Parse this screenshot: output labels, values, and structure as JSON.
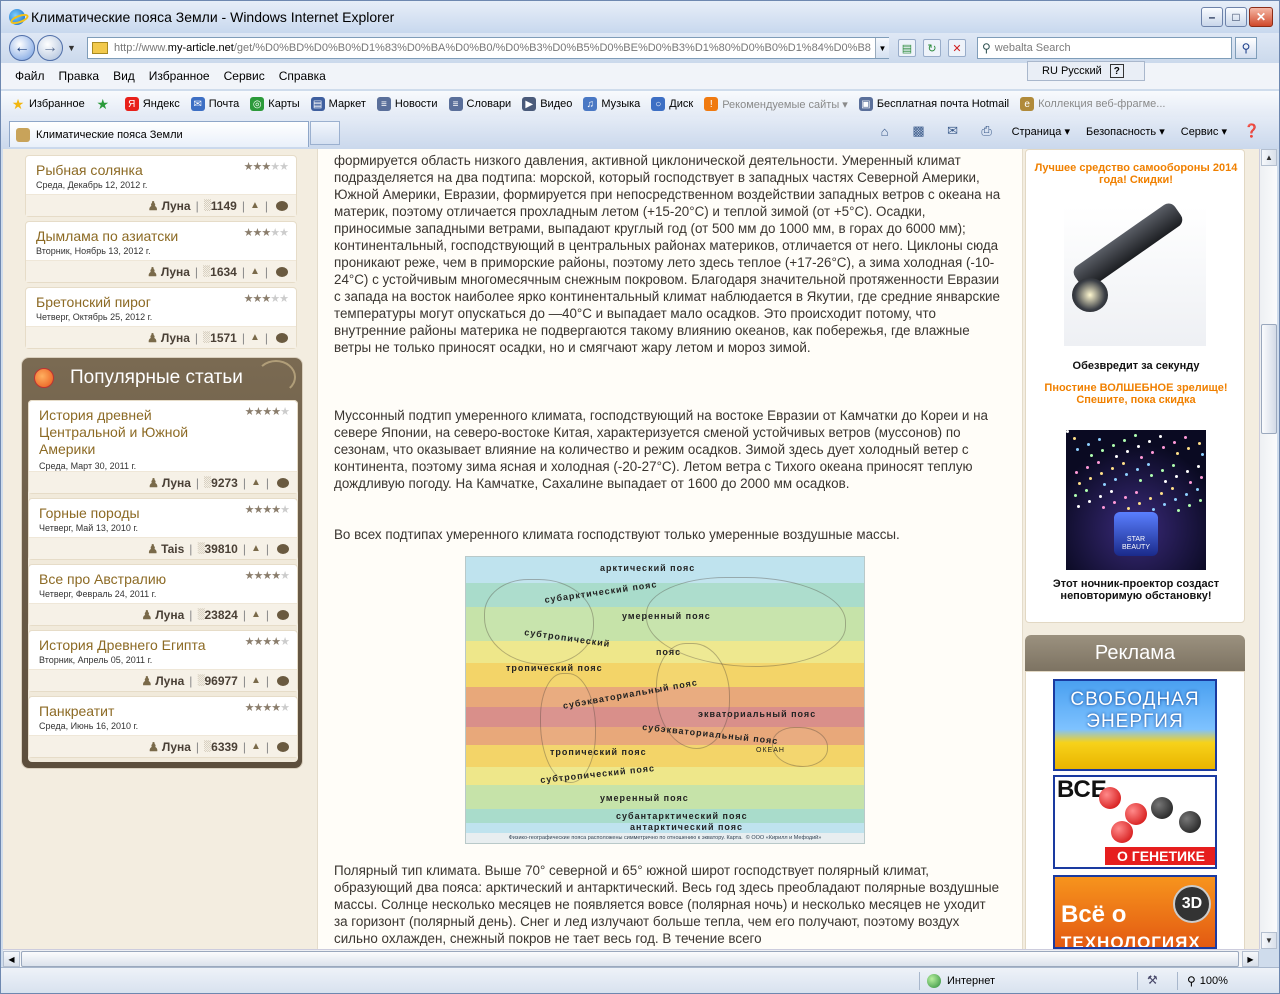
{
  "window": {
    "title": "Климатические пояса Земли - Windows Internet Explorer",
    "minimize": "–",
    "maximize": "□",
    "close": "✕"
  },
  "address": {
    "prefix": "http://www.",
    "host": "my-article.net",
    "path": "/get/%D0%BD%D0%B0%D1%83%D0%BA%D0%B0/%D0%B3%D0%B5%D0%BE%D0%B3%D1%80%D0%B0%D1%84%D0%B8"
  },
  "search": {
    "placeholder": "webalta Search"
  },
  "language": {
    "label": "RU Русский",
    "help": "?"
  },
  "menu": [
    "Файл",
    "Правка",
    "Вид",
    "Избранное",
    "Сервис",
    "Справка"
  ],
  "favorites": {
    "main": "Избранное",
    "items": [
      {
        "label": "Яндекс",
        "icon": "yandex-icon",
        "color": "#e8201a",
        "glyph": "Я"
      },
      {
        "label": "Почта",
        "icon": "mail-icon",
        "color": "#3d6fc4",
        "glyph": "✉"
      },
      {
        "label": "Карты",
        "icon": "maps-icon",
        "color": "#2c9a3a",
        "glyph": "◎"
      },
      {
        "label": "Маркет",
        "icon": "market-icon",
        "color": "#3f5f9f",
        "glyph": "▤"
      },
      {
        "label": "Новости",
        "icon": "news-icon",
        "color": "#5a6f9a",
        "glyph": "≡"
      },
      {
        "label": "Словари",
        "icon": "dictionary-icon",
        "color": "#5a6f9a",
        "glyph": "≡"
      },
      {
        "label": "Видео",
        "icon": "video-icon",
        "color": "#4a5a7a",
        "glyph": "▶"
      },
      {
        "label": "Музыка",
        "icon": "music-icon",
        "color": "#4a78c4",
        "glyph": "♫"
      },
      {
        "label": "Диск",
        "icon": "disk-icon",
        "color": "#3d6fc4",
        "glyph": "○"
      },
      {
        "label": "Рекомендуемые сайты ▾",
        "icon": "suggested-sites-icon",
        "color": "#f07a10",
        "glyph": "!",
        "dim": true
      },
      {
        "label": "Бесплатная почта Hotmail",
        "icon": "hotmail-icon",
        "color": "#5a6f9a",
        "glyph": "▣"
      },
      {
        "label": "Коллекция веб-фрагме...",
        "icon": "webslice-icon",
        "color": "#b08a3a",
        "glyph": "e",
        "dim": true
      }
    ]
  },
  "tab": {
    "title": "Климатические пояса Земли"
  },
  "commands": {
    "page": "Страница ▾",
    "safety": "Безопасность ▾",
    "service": "Сервис ▾"
  },
  "recipes": [
    {
      "title": "Рыбная солянка",
      "date": "Среда, Декабрь 12, 2012 г.",
      "author": "Луна",
      "views": "1149",
      "stars": 3
    },
    {
      "title": "Дымлама по азиатски",
      "date": "Вторник, Ноябрь 13, 2012 г.",
      "author": "Луна",
      "views": "1634",
      "stars": 3
    },
    {
      "title": "Бретонский пирог",
      "date": "Четверг, Октябрь 25, 2012 г.",
      "author": "Луна",
      "views": "1571",
      "stars": 3
    }
  ],
  "popular": {
    "title": "Популярные статьи",
    "items": [
      {
        "title": "История древней Центральной и Южной Америки",
        "date": "Среда, Март 30, 2011 г.",
        "author": "Луна",
        "views": "9273",
        "stars": 4
      },
      {
        "title": "Горные породы",
        "date": "Четверг, Май 13, 2010 г.",
        "author": "Tais",
        "views": "39810",
        "stars": 4
      },
      {
        "title": "Все про Австралию",
        "date": "Четверг, Февраль 24, 2011 г.",
        "author": "Луна",
        "views": "23824",
        "stars": 4
      },
      {
        "title": "История Древнего Египта",
        "date": "Вторник, Апрель 05, 2011 г.",
        "author": "Луна",
        "views": "96977",
        "stars": 4
      },
      {
        "title": "Панкреатит",
        "date": "Среда, Июнь 16, 2010 г.",
        "author": "Луна",
        "views": "6339",
        "stars": 4
      }
    ]
  },
  "article": {
    "p1": "формируется область низкого давления, активной циклонической деятельности. Умеренный климат подразделяется на два подтипа: морской, который господствует в западных частях Северной Америки, Южной Америки, Евразии, формируется при непосредственном воздействии западных ветров с океана на материк, поэтому отличается прохладным летом (+15-20°С) и теплой зимой (от +5°С). Осадки, приносимые западными ветрами, выпадают круглый год (от 500 мм до 1000 мм, в горах до 6000 мм); континентальный, господствующий в центральных районах материков, отличается от него. Циклоны сюда проникают реже, чем в приморские районы, поэтому лето здесь теплое (+17-26°С), а зима холодная (-10-24°С) с устойчивым многомесячным снежным покровом. Благодаря значительной протяженности Евразии с запада на восток наиболее ярко континентальный климат наблюдается в Якутии, где средние январские температуры могут опускаться до —40°С и выпадает мало осадков. Это происходит потому, что внутренние районы материка не подвергаются такому влиянию океанов, как побережья, где влажные ветры не только приносят осадки, но и смягчают жару летом и мороз зимой.",
    "p2": "Муссонный подтип умеренного климата, господствующий на востоке Евразии от Камчатки до Кореи и на севере Японии, на северо-востоке Китая, характеризуется сменой устойчивых ветров (муссонов) по сезонам, что оказывает влияние на количество и режим осадков. Зимой здесь дует холодный ветер с континента, поэтому зима ясная и холодная (-20-27°С). Летом ветра с Тихого океана приносят теплую дождливую погоду. На Камчатке, Сахалине выпадает от 1600 до 2000 мм осадков.",
    "p3": "Во всех подтипах умеренного климата господствуют только умеренные воздушные массы.",
    "p4": "Полярный тип климата. Выше 70° северной и 65° южной широт господствует полярный климат, образующий два пояса: арктический и антарктический. Весь год здесь преобладают полярные воздушные массы. Солнце несколько месяцев не появляется вовсе (полярная ночь) и несколько месяцев не уходит за горизонт (полярный день). Снег и лед излучают больше тепла, чем его получают, поэтому воздух сильно охлажден, снежный покров не тает весь год. В течение всего"
  },
  "map": {
    "labels": {
      "arctic": "арктический пояс",
      "subarctic": "субарктический пояс",
      "temperate_n": "умеренный пояс",
      "subtropical_n": "субтропический",
      "subtropical_n2": "пояс",
      "tropical_n": "тропический пояс",
      "subequatorial_n": "субэкваториальный пояс",
      "equatorial": "экваториальный пояс",
      "subequatorial_s": "субэкваториальный пояс",
      "tropical_s": "тропический пояс",
      "subtropical_s": "субтропический пояс",
      "temperate_s": "умеренный пояс",
      "subantarctic": "субантарктический пояс",
      "antarctic": "антарктический пояс",
      "ocean": "ОКЕАН"
    },
    "caption": "Физико-географические пояса расположены симметрично по отношению к экватору. Карта.",
    "copyright": "© ООО «Кирилл и Мефодий»",
    "colors": {
      "arctic": "#bfe3ee",
      "subarctic": "#a9dccb",
      "temperate": "#c6e3a9",
      "subtropical": "#eee78a",
      "tropical": "#f3d468",
      "subequatorial": "#e8a87a",
      "equatorial": "#d98f8a"
    }
  },
  "ads": {
    "a1": "Лучшее средство самообороны 2014 года! Скидки!",
    "a1_caption": "Обезвредит за секунду",
    "a2": "Пностине ВОЛШЕБНОЕ зрелище! Спешите, пока скидка",
    "a2_caption": "Этот ночник-проектор создаст неповторимую обстановку!",
    "lamp_text": "STAR BEAUTY",
    "reklama": "Реклама",
    "b1": "СВОБОДНАЯ ЭНЕРГИЯ",
    "b1_line1": "СВОБОДНАЯ",
    "b1_line2": "ЭНЕРГИЯ",
    "b2_letters": "ВСЕ",
    "b2_bottom": "О ГЕНЕТИКЕ",
    "b3_line1": "Всё о",
    "b3_badge": "3D",
    "b3_line2": "ТЕХНОЛОГИЯХ"
  },
  "status": {
    "zone": "Интернет",
    "zoom": "100%"
  }
}
